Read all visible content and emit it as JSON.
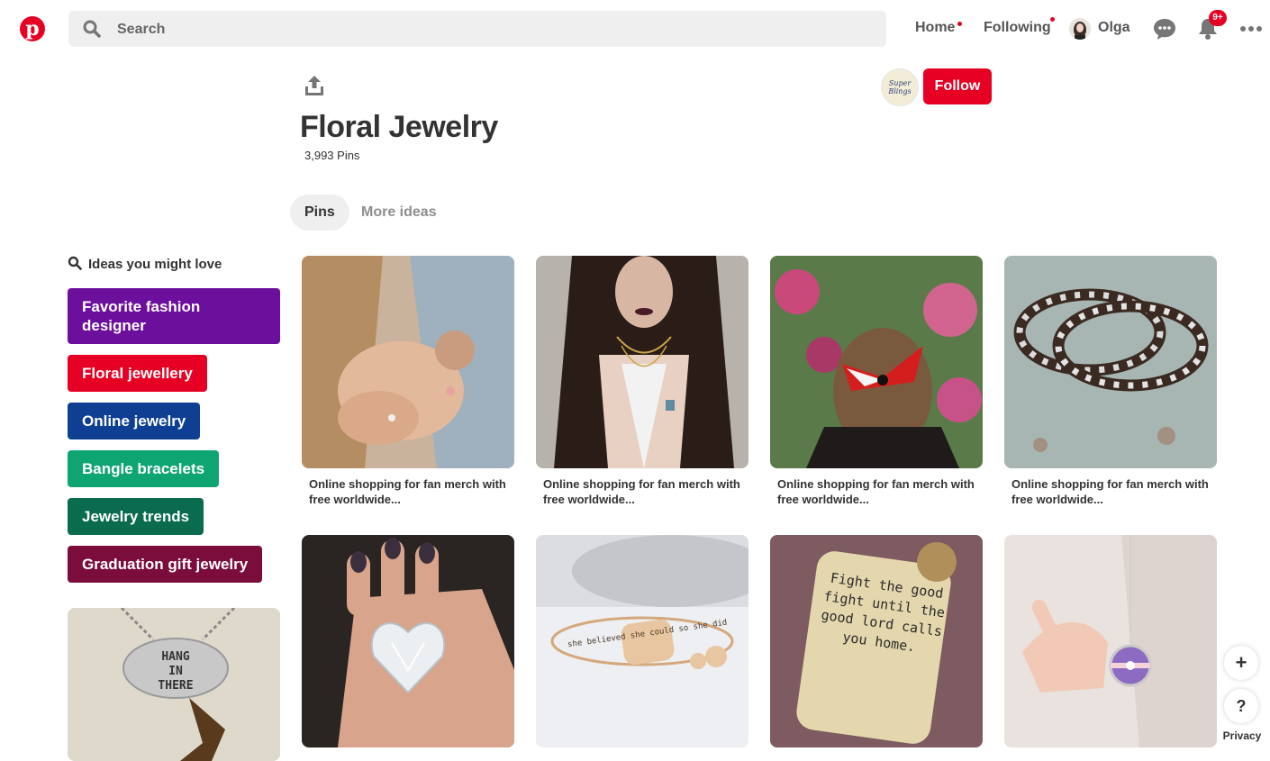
{
  "header": {
    "search_placeholder": "Search",
    "nav": {
      "home": "Home",
      "following": "Following",
      "user": "Olga"
    },
    "notifications_badge": "9+"
  },
  "board": {
    "title": "Floral Jewelry",
    "pin_count": "3,993 Pins",
    "owner_avatar_text": "Super Blings",
    "follow_label": "Follow",
    "tabs": [
      "Pins",
      "More ideas"
    ]
  },
  "sidebar": {
    "heading": "Ideas you might love",
    "chips": [
      {
        "label": "Favorite fashion designer",
        "color": "#6b0f9c"
      },
      {
        "label": "Floral jewellery",
        "color": "#e60023"
      },
      {
        "label": "Online jewelry",
        "color": "#0f3f93"
      },
      {
        "label": "Bangle bracelets",
        "color": "#0fa573"
      },
      {
        "label": "Jewelry trends",
        "color": "#0a6b4e"
      },
      {
        "label": "Graduation gift jewelry",
        "color": "#7a0d3c"
      }
    ],
    "pin_text": "HANG IN THERE"
  },
  "pins": [
    {
      "caption": "Online shopping for fan merch with free worldwide..."
    },
    {
      "caption": "Online shopping for fan merch with free worldwide..."
    },
    {
      "caption": "Online shopping for fan merch with free worldwide..."
    },
    {
      "caption": "Online shopping for fan merch with free worldwide..."
    },
    {
      "text": ""
    },
    {
      "text": "she believed she could so she did"
    },
    {
      "text": "Fight the good fight until the good lord calls you home."
    },
    {
      "text": ""
    }
  ],
  "fab": {
    "add": "+",
    "help": "?"
  },
  "footer": {
    "privacy": "Privacy"
  },
  "colors": {
    "brand": "#e60023"
  }
}
